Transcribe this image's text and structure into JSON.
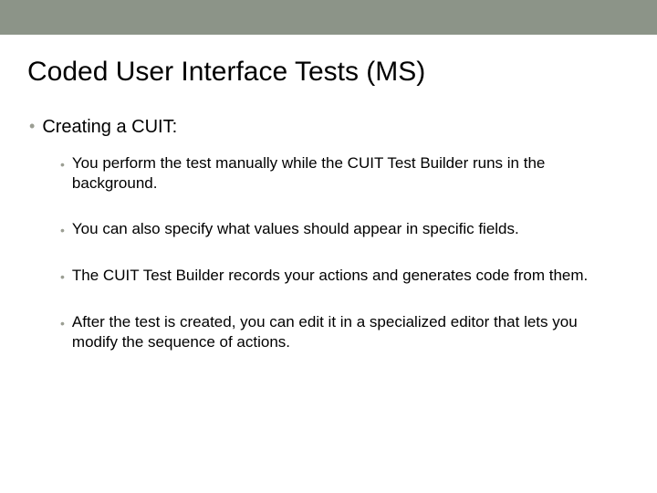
{
  "slide": {
    "title": "Coded User Interface Tests (MS)",
    "l1": {
      "text": "Creating a CUIT:"
    },
    "l2": {
      "items": [
        "You perform the test manually while the CUIT Test Builder runs in the background.",
        "You can also specify what values should appear in specific fields.",
        "The CUIT Test Builder records your actions and generates code from them.",
        "After the test is created, you can edit it in a specialized editor that lets you modify the sequence of actions."
      ]
    }
  },
  "colors": {
    "topbar": "#8c9488",
    "bullet_marker": "#9b9e93"
  }
}
